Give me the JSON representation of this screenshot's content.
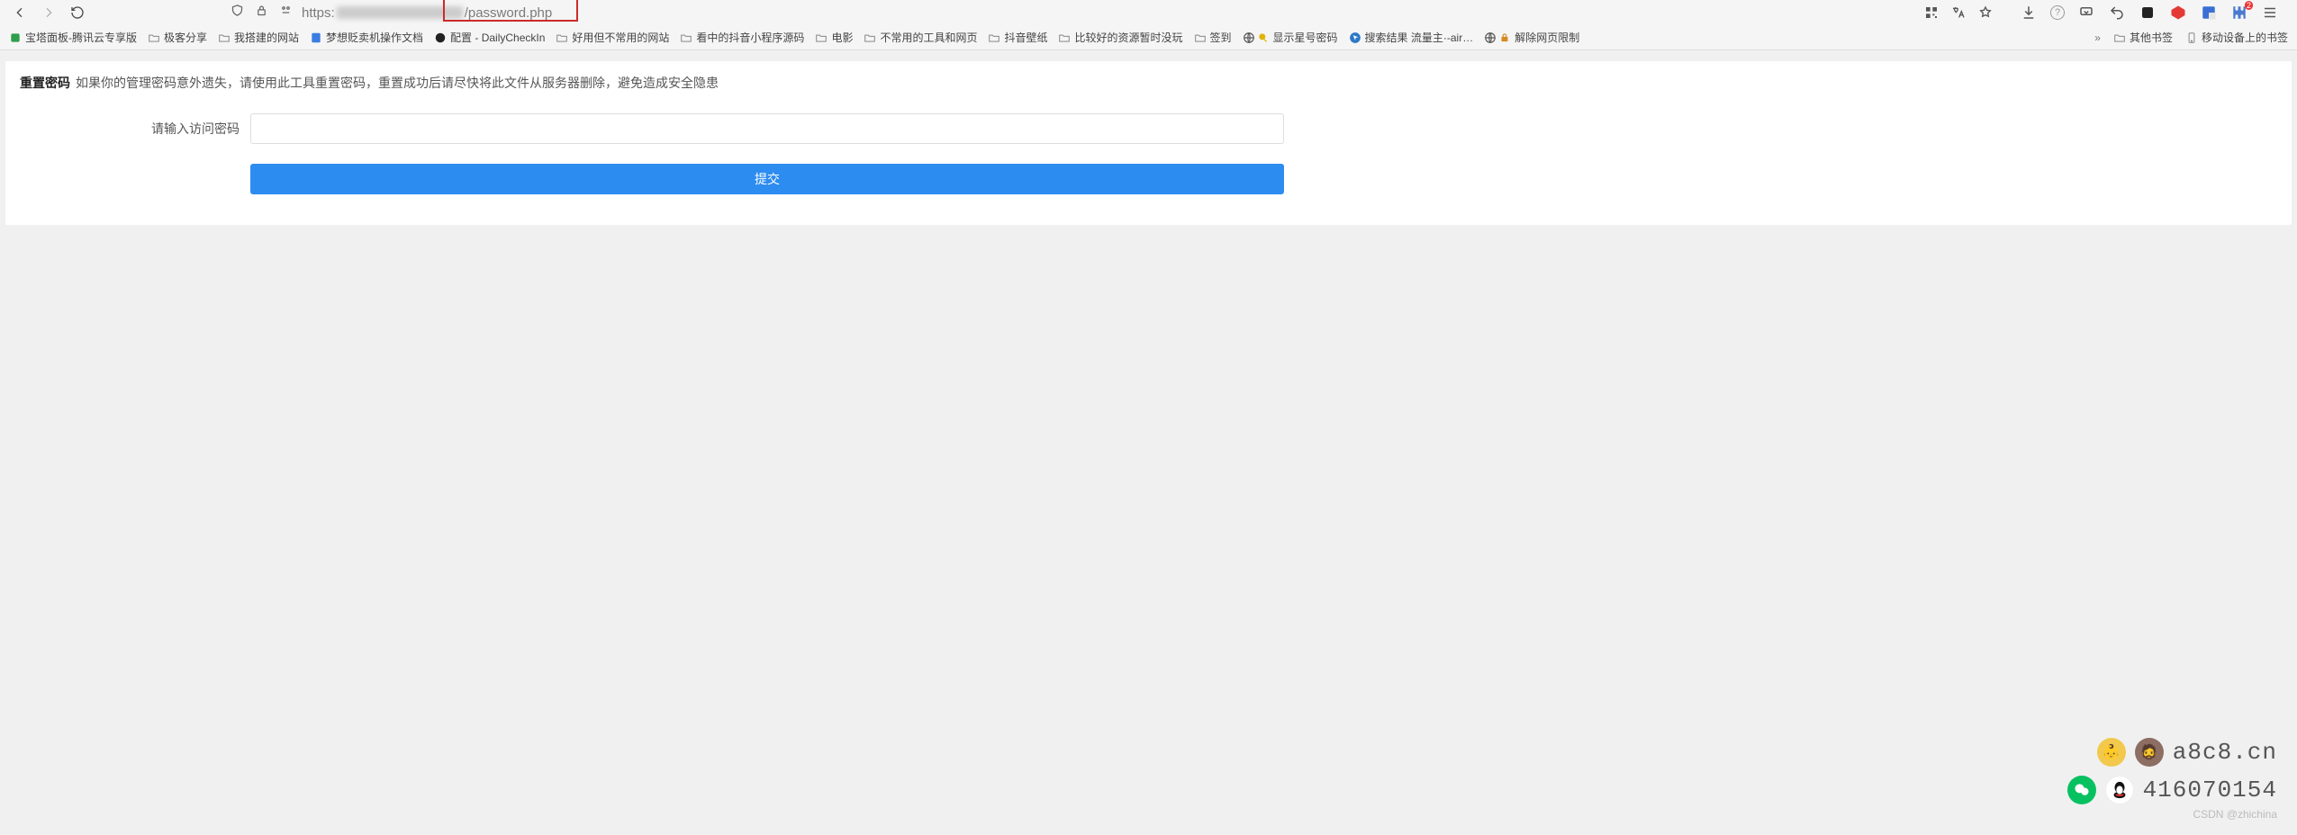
{
  "urlbar": {
    "scheme": "https:",
    "path": "/password.php"
  },
  "bookmarks": {
    "items": [
      "宝塔面板-腾讯云专享版",
      "极客分享",
      "我搭建的网站",
      "梦想贬卖机操作文档",
      "配置 - DailyCheckIn",
      "好用但不常用的网站",
      "看中的抖音小程序源码",
      "电影",
      "不常用的工具和网页",
      "抖音壁纸",
      "比较好的资源暂时没玩",
      "签到",
      "显示星号密码",
      "搜索结果 流量主·-air…",
      "解除网页限制"
    ],
    "other": "其他书签",
    "mobile": "移动设备上的书签"
  },
  "content": {
    "title": "重置密码",
    "desc": "如果你的管理密码意外遗失，请使用此工具重置密码，重置成功后请尽快将此文件从服务器删除，避免造成安全隐患",
    "label": "请输入访问密码",
    "submit": "提交"
  },
  "floating": {
    "site": "a8c8.cn",
    "qq": "416070154",
    "watermark": "CSDN @zhichina"
  }
}
